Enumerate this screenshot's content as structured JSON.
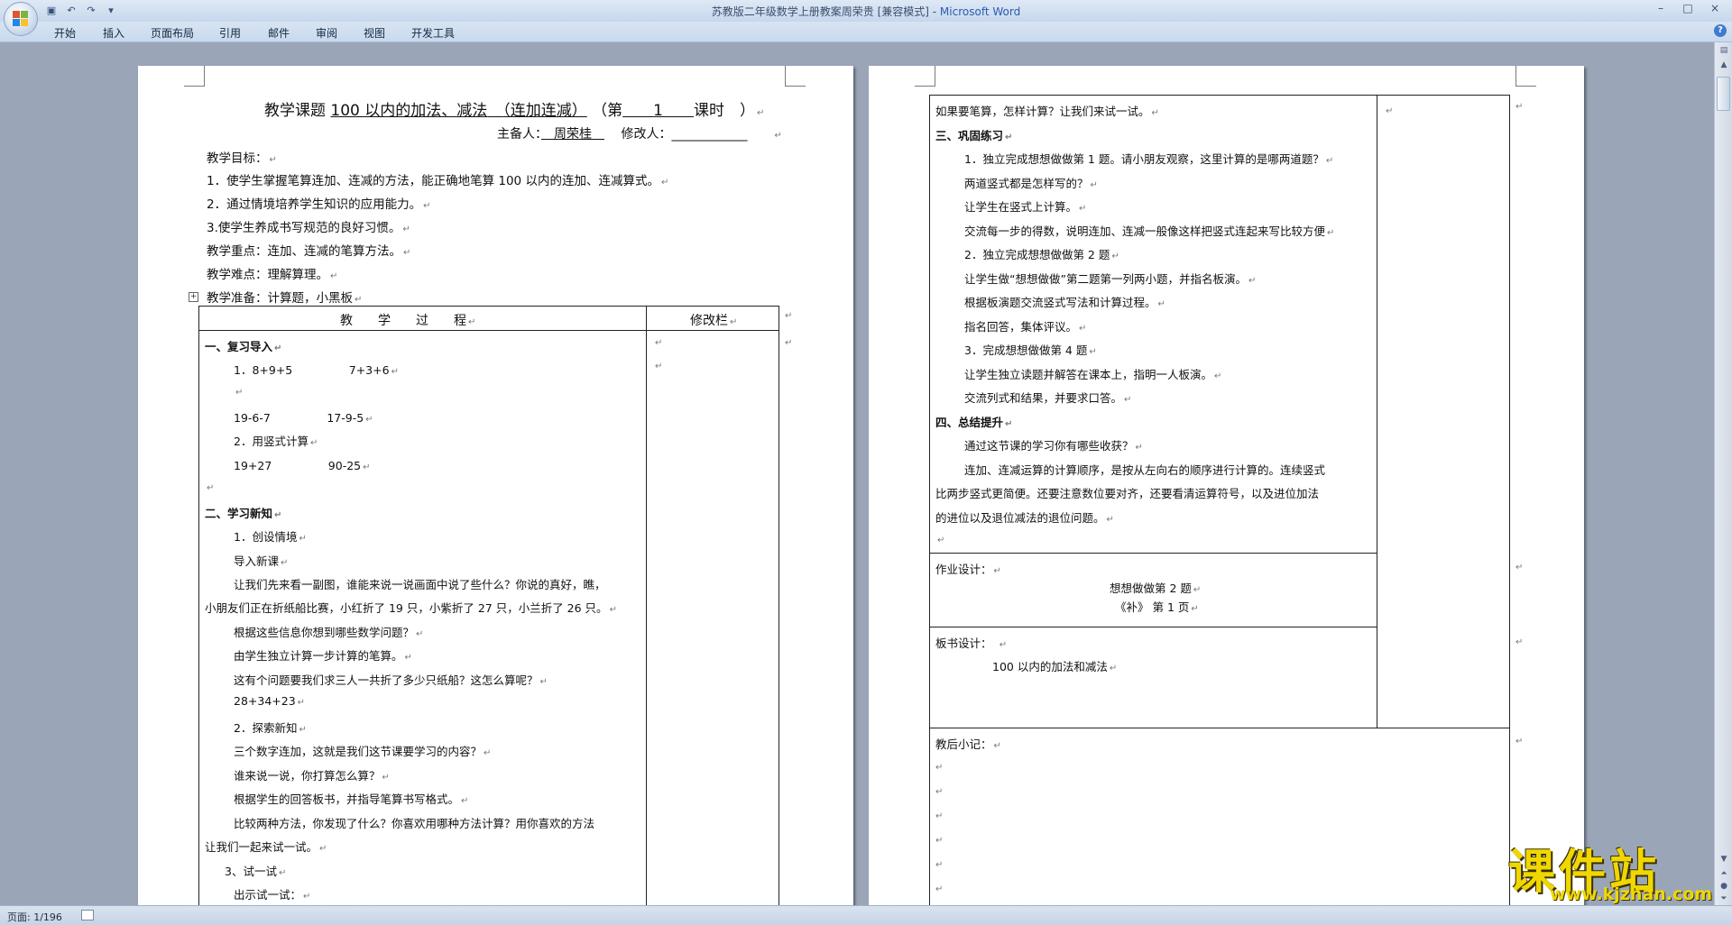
{
  "window": {
    "title_prefix": "苏教版二年级数学上册教案周荣贵 [兼容模式] - ",
    "title_app": "Microsoft Word",
    "minimize": "–",
    "maximize": "□",
    "close": "×"
  },
  "quick_access": [
    "save-icon",
    "undo-icon",
    "redo-icon",
    "customize-icon"
  ],
  "ribbon": {
    "tabs": [
      "开始",
      "插入",
      "页面布局",
      "引用",
      "邮件",
      "审阅",
      "视图",
      "开发工具"
    ],
    "help": "?"
  },
  "status": {
    "page": "页面: 1/196"
  },
  "page1": {
    "title": {
      "label": "教学课题",
      "topic": "100 以内的加法、减法",
      "sub": "（连加连减）",
      "paren_open": "（",
      "di": "第",
      "num": "1",
      "keshi": "课时",
      "paren_close": "）"
    },
    "presenter_label": "主备人：",
    "presenter": "周荣桂",
    "reviser_label": "修改人：",
    "reviser": "____________",
    "goals_title": "教学目标：",
    "goals": [
      "1．使学生掌握笔算连加、连减的方法，能正确地笔算 100 以内的连加、连减算式。",
      "2．通过情境培养学生知识的应用能力。",
      "3.使学生养成书写规范的良好习惯。"
    ],
    "key_point": "教学重点：连加、连减的笔算方法。",
    "difficulty": "教学难点：理解算理。",
    "prep": "教学准备：计算题，小黑板",
    "table_header_process": "教　　学　　过　　程",
    "table_header_notes": "修改栏",
    "process": [
      {
        "text": "一、复习导入",
        "bold": true
      },
      {
        "text": "1．8+9+5　　　　　7+3+6"
      },
      {
        "text": ""
      },
      {
        "text": "19-6-7　　　　　17-9-5"
      },
      {
        "text": "2．用竖式计算"
      },
      {
        "text": "19+27　　　　　90-25"
      },
      {
        "text": ""
      },
      {
        "text": "二、学习新知",
        "bold": true
      },
      {
        "text": "1．创设情境"
      },
      {
        "text": "导入新课"
      },
      {
        "text": "让我们先来看一副图，谁能来说一说画面中说了些什么？你说的真好，瞧，"
      },
      {
        "text": "小朋友们正在折纸船比赛，小红折了 19 只，小紫折了 27 只，小兰折了 26 只。"
      },
      {
        "text": "根据这些信息你想到哪些数学问题？"
      },
      {
        "text": "由学生独立计算一步计算的笔算。"
      },
      {
        "text": "这有个问题要我们求三人一共折了多少只纸船？这怎么算呢？"
      },
      {
        "text": "28+34+23"
      },
      {
        "text": "2．探索新知"
      },
      {
        "text": "三个数字连加，这就是我们这节课要学习的内容？"
      },
      {
        "text": "谁来说一说，你打算怎么算？"
      },
      {
        "text": "根据学生的回答板书，并指导笔算书写格式。"
      },
      {
        "text": "比较两种方法，你发现了什么？你喜欢用哪种方法计算？用你喜欢的方法"
      },
      {
        "text": "让我们一起来试一试。"
      },
      {
        "text": "3、试一试"
      },
      {
        "text": "出示试一试："
      }
    ]
  },
  "page2": {
    "process": [
      {
        "text": "如果要笔算，怎样计算？让我们来试一试。"
      },
      {
        "text": "三、巩固练习",
        "bold": true
      },
      {
        "text": "1．独立完成想想做做第 1 题。请小朋友观察，这里计算的是哪两道题？"
      },
      {
        "text": "两道竖式都是怎样写的？"
      },
      {
        "text": "让学生在竖式上计算。"
      },
      {
        "text": "交流每一步的得数，说明连加、连减一般像这样把竖式连起来写比较方便"
      },
      {
        "text": "2．独立完成想想做做第 2 题"
      },
      {
        "text": "让学生做“想想做做”第二题第一列两小题，并指名板演。"
      },
      {
        "text": "根据板演题交流竖式写法和计算过程。"
      },
      {
        "text": "指名回答，集体评议。"
      },
      {
        "text": "3．完成想想做做第 4 题"
      },
      {
        "text": "让学生独立读题并解答在课本上，指明一人板演。"
      },
      {
        "text": "交流列式和结果，并要求口答。"
      },
      {
        "text": "四、总结提升",
        "bold": true
      },
      {
        "text": "通过这节课的学习你有哪些收获？"
      },
      {
        "text": "连加、连减运算的计算顺序，是按从左向右的顺序进行计算的。连续竖式"
      },
      {
        "text": "比两步竖式更简便。还要注意数位要对齐，还要看清运算符号，以及进位加法"
      },
      {
        "text": "的进位以及退位减法的退位问题。"
      },
      {
        "text": ""
      }
    ],
    "homework_label": "作业设计：",
    "homework_lines": [
      "想想做做第 2 题",
      "《补》 第 1 页"
    ],
    "board_label": "板书设计：",
    "board_line": "100 以内的加法和减法",
    "after_label": "教后小记："
  },
  "watermark": {
    "brand": "课件站",
    "url": "www.kjzhan.com"
  }
}
